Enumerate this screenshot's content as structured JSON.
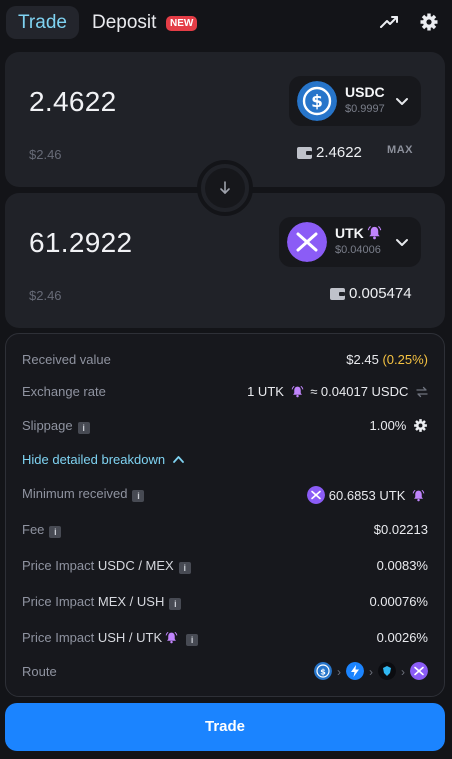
{
  "tabs": {
    "trade": "Trade",
    "deposit": "Deposit",
    "new_badge": "NEW"
  },
  "from": {
    "amount": "2.4622",
    "usd": "$2.46",
    "token": "USDC",
    "token_price": "$0.9997",
    "balance": "2.4622",
    "max_label": "MAX"
  },
  "to": {
    "amount": "61.2922",
    "usd": "$2.46",
    "token": "UTK",
    "token_price": "$0.04006",
    "balance": "0.005474"
  },
  "details": {
    "received": {
      "label": "Received value",
      "value": "$2.45",
      "pct": "(0.25%)"
    },
    "rate": {
      "label": "Exchange rate",
      "value_left": "1 UTK",
      "value_right": "≈ 0.04017 USDC"
    },
    "slippage": {
      "label": "Slippage",
      "value": "1.00%"
    },
    "hide_link": "Hide detailed breakdown",
    "min_received": {
      "label": "Minimum received",
      "value": "60.6853 UTK"
    },
    "fee": {
      "label": "Fee",
      "value": "$0.02213"
    },
    "impact1": {
      "prefix": "Price Impact",
      "pair": "USDC / MEX",
      "value": "0.0083%"
    },
    "impact2": {
      "prefix": "Price Impact",
      "pair": "MEX / USH",
      "value": "0.00076%"
    },
    "impact3": {
      "prefix": "Price Impact",
      "pair": "USH / UTK",
      "value": "0.0026%"
    },
    "route": {
      "label": "Route"
    }
  },
  "trade_button": "Trade",
  "colors": {
    "accent": "#7fd3f2",
    "button": "#1b84ff",
    "warning": "#f5c242",
    "usdc": "#2775ca",
    "utk": "#8b5cf6",
    "badge": "#e43d46"
  },
  "icons": [
    "trending-up-icon",
    "settings-gear-icon",
    "usdc-token-icon",
    "utk-token-icon",
    "bell-icon",
    "chevron-down-icon",
    "wallet-icon",
    "arrow-down-icon",
    "swap-arrows-icon",
    "info-icon",
    "chevron-up-icon",
    "route-token-icon"
  ]
}
